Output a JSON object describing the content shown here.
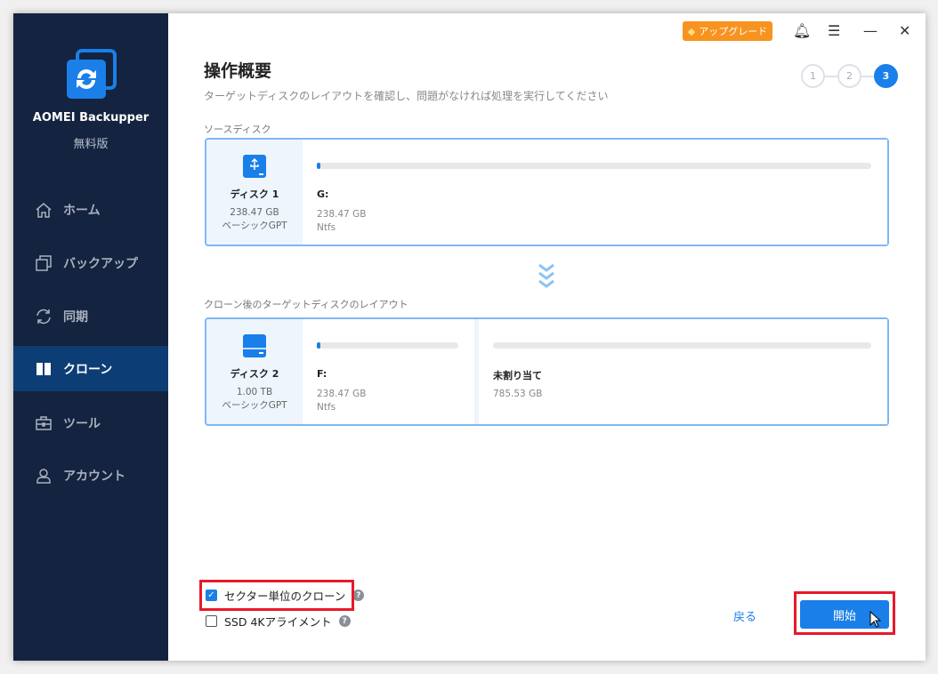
{
  "app": {
    "name": "AOMEI Backupper",
    "edition": "無料版"
  },
  "sidebar": {
    "items": [
      {
        "label": "ホーム",
        "icon": "home-icon"
      },
      {
        "label": "バックアップ",
        "icon": "backup-icon"
      },
      {
        "label": "同期",
        "icon": "sync-icon"
      },
      {
        "label": "クローン",
        "icon": "clone-icon",
        "active": true
      },
      {
        "label": "ツール",
        "icon": "toolbox-icon"
      },
      {
        "label": "アカウント",
        "icon": "user-icon"
      }
    ]
  },
  "titlebar": {
    "upgrade": "アップグレード"
  },
  "header": {
    "title": "操作概要",
    "subtitle": "ターゲットディスクのレイアウトを確認し、問題がなければ処理を実行してください"
  },
  "steps": [
    "1",
    "2",
    "3"
  ],
  "source": {
    "label": "ソースディスク",
    "disk": {
      "name": "ディスク 1",
      "size": "238.47 GB",
      "type": "ベーシックGPT"
    },
    "partitions": [
      {
        "name": "G:",
        "size": "238.47 GB",
        "fs": "Ntfs"
      }
    ]
  },
  "target": {
    "label": "クローン後のターゲットディスクのレイアウト",
    "disk": {
      "name": "ディスク 2",
      "size": "1.00 TB",
      "type": "ベーシックGPT"
    },
    "partitions": [
      {
        "name": "F:",
        "size": "238.47 GB",
        "fs": "Ntfs"
      },
      {
        "name": "未割り当て",
        "size": "785.53 GB"
      }
    ]
  },
  "options": {
    "sector": {
      "label": "セクター単位のクローン",
      "checked": true
    },
    "ssd": {
      "label": "SSD 4Kアライメント",
      "checked": false
    }
  },
  "buttons": {
    "back": "戻る",
    "start": "開始"
  },
  "colors": {
    "accent": "#1a7fe8",
    "sidebar": "#14233f",
    "upgrade": "#f7931e",
    "highlight": "#e8192c"
  }
}
